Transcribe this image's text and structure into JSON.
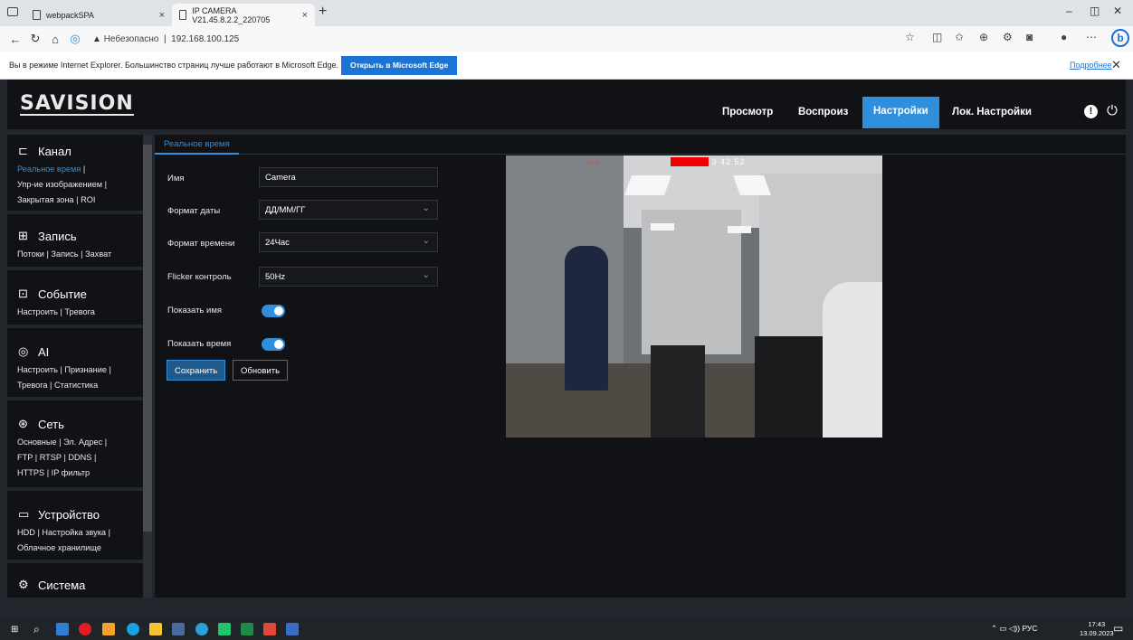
{
  "browser": {
    "tabs": [
      {
        "title": "webpackSPA"
      },
      {
        "title": "IP CAMERA V21.45.8.2.2_220705"
      }
    ],
    "address": {
      "insecure_label": "Небезопасно",
      "url": "192.168.100.125"
    }
  },
  "ie_bar": {
    "message": "Вы в режиме Internet Explorer. Большинство страниц лучше работают в Microsoft Edge.",
    "open_button": "Открыть в Microsoft Edge",
    "more_link": "Подробнее"
  },
  "app": {
    "logo": "SAVISION",
    "nav": [
      "Просмотр",
      "Воспроиз",
      "Настройки",
      "Лок. Настройки"
    ],
    "active_nav": "Настройки",
    "sidebar": [
      {
        "title": "Канал",
        "icon": "channel-icon",
        "lines": [
          [
            "Реальное время",
            "|"
          ],
          [
            "Упр-ие изображением",
            "|"
          ],
          [
            "Закрытая зона",
            "|",
            "ROI"
          ]
        ]
      },
      {
        "title": "Запись",
        "icon": "record-icon",
        "lines": [
          [
            "Потоки",
            "|",
            "Запись",
            "|",
            "Захват"
          ]
        ]
      },
      {
        "title": "Событие",
        "icon": "event-icon",
        "lines": [
          [
            "Настроить",
            "|",
            "Тревога"
          ]
        ]
      },
      {
        "title": "AI",
        "icon": "ai-icon",
        "lines": [
          [
            "Настроить",
            "|",
            "Признание",
            "|"
          ],
          [
            "Тревога",
            "|",
            "Статистика"
          ]
        ]
      },
      {
        "title": "Сеть",
        "icon": "network-icon",
        "lines": [
          [
            "Основные",
            "|",
            "Эл. Адрес",
            "|"
          ],
          [
            "FTP",
            "|",
            "RTSP",
            "|",
            "DDNS",
            "|"
          ],
          [
            "HTTPS",
            "|",
            "IP фильтр"
          ]
        ]
      },
      {
        "title": "Устройство",
        "icon": "device-icon",
        "lines": [
          [
            "HDD",
            "|",
            "Настройка звука",
            "|"
          ],
          [
            "Облачное хранилище"
          ]
        ]
      },
      {
        "title": "Система",
        "icon": "system-icon",
        "lines": []
      }
    ],
    "content_tab": "Реальное время",
    "form": {
      "name_label": "Имя",
      "name_value": "Camera",
      "date_format_label": "Формат даты",
      "date_format_value": "ДД/ММ/ГГ",
      "time_format_label": "Формат времени",
      "time_format_value": "24Час",
      "flicker_label": "Flicker контроль",
      "flicker_value": "50Hz",
      "show_name_label": "Показать имя",
      "show_time_label": "Показать время",
      "show_name_on": true,
      "show_time_on": true,
      "save_button": "Сохранить",
      "refresh_button": "Обновить"
    },
    "camera_overlay": {
      "name": "era",
      "time": "3 42 52"
    }
  },
  "taskbar": {
    "lang": "РУС",
    "time": "17:43",
    "date": "13.09.2023"
  },
  "colors": {
    "accent": "#2f8fdc",
    "bg_dark": "#101215",
    "bg_mid": "#23262d"
  }
}
